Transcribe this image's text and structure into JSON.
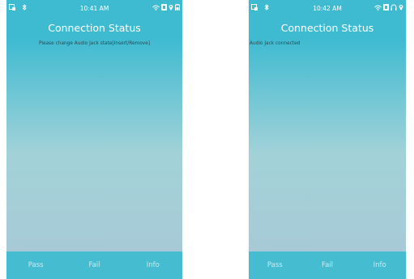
{
  "screens": [
    {
      "status": {
        "time": "10:41 AM"
      },
      "title": "Connection Status",
      "message": "Please change Audio Jack state[Insert/Remove]",
      "buttons": {
        "pass": "Pass",
        "fail": "Fail",
        "info": "Info"
      }
    },
    {
      "status": {
        "time": "10:42 AM"
      },
      "title": "Connection Status",
      "message": "Audio Jack connected",
      "buttons": {
        "pass": "Pass",
        "fail": "Fail",
        "info": "Info"
      }
    }
  ],
  "colors": {
    "header": "#3fbbd1",
    "bottom_bar": "#45bcd0",
    "background_bottom": "#a9c8d6",
    "message_text": "#2b4a52"
  },
  "icons": {
    "status_left": [
      "notification-icon",
      "bluetooth-icon"
    ],
    "status_right_screen1": [
      "wifi-icon",
      "sim-icon",
      "location-icon",
      "battery-icon"
    ],
    "status_right_screen2": [
      "wifi-icon",
      "sim-icon",
      "headset-icon",
      "location-icon"
    ]
  }
}
